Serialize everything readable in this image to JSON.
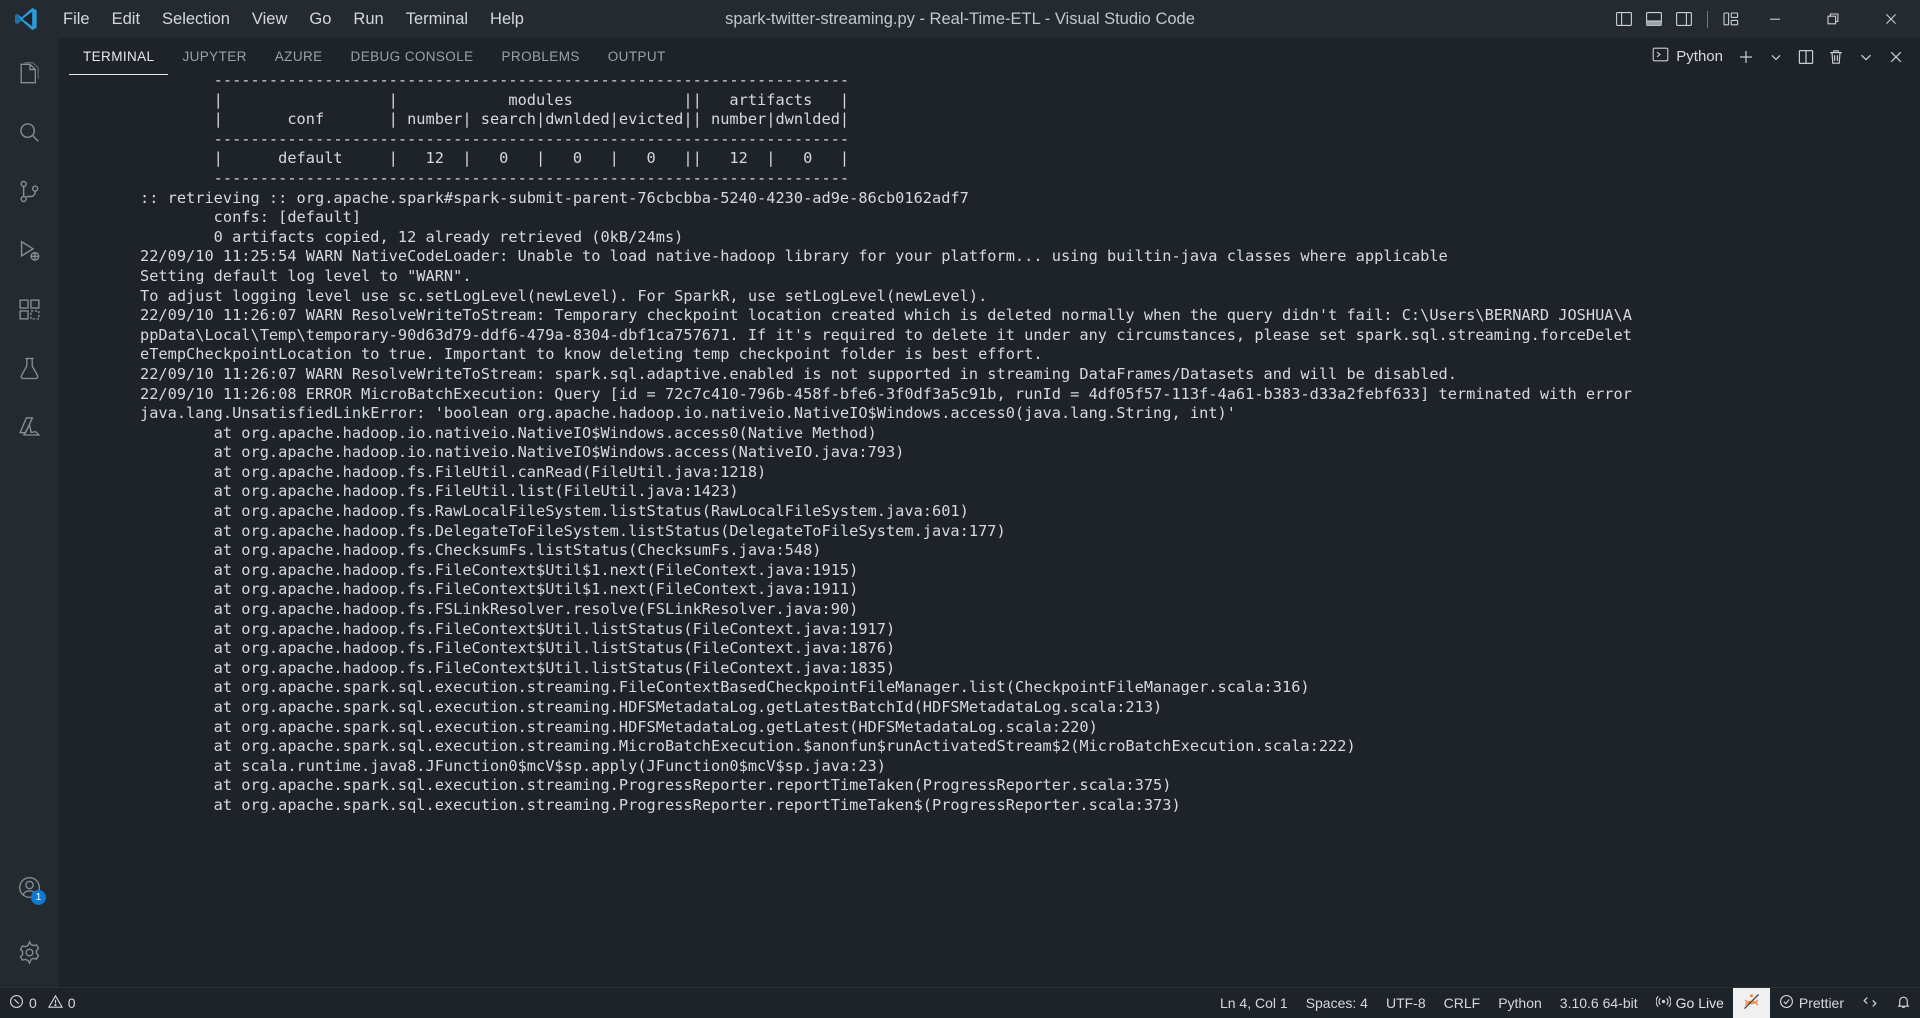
{
  "titlebar": {
    "logo_icon": "vscode-logo-icon",
    "menus": [
      "File",
      "Edit",
      "Selection",
      "View",
      "Go",
      "Run",
      "Terminal",
      "Help"
    ],
    "window_title": "spark-twitter-streaming.py - Real-Time-ETL - Visual Studio Code",
    "layout_buttons": [
      {
        "icon": "toggle-primary-sidebar-icon",
        "name": "toggle-primary-sidebar"
      },
      {
        "icon": "toggle-panel-icon",
        "name": "toggle-panel"
      },
      {
        "icon": "toggle-secondary-sidebar-icon",
        "name": "toggle-secondary-sidebar"
      },
      {
        "icon": "customize-layout-icon",
        "name": "customize-layout"
      }
    ],
    "window_controls": [
      {
        "name": "minimize-button",
        "icon": "minimize-icon"
      },
      {
        "name": "restore-button",
        "icon": "restore-icon"
      },
      {
        "name": "close-button",
        "icon": "close-icon"
      }
    ]
  },
  "activitybar": {
    "items": [
      {
        "name": "explorer",
        "icon": "files-icon"
      },
      {
        "name": "search",
        "icon": "search-icon"
      },
      {
        "name": "source-control",
        "icon": "source-control-icon"
      },
      {
        "name": "run-and-debug",
        "icon": "debug-icon"
      },
      {
        "name": "extensions",
        "icon": "extensions-icon"
      },
      {
        "name": "testing",
        "icon": "beaker-icon"
      },
      {
        "name": "azure",
        "icon": "azure-icon"
      }
    ],
    "bottom_items": [
      {
        "name": "accounts",
        "icon": "account-icon",
        "badge": "1"
      },
      {
        "name": "manage",
        "icon": "gear-icon",
        "badge": ""
      }
    ]
  },
  "panel": {
    "tabs": [
      {
        "label": "TERMINAL",
        "active": true
      },
      {
        "label": "JUPYTER",
        "active": false
      },
      {
        "label": "AZURE",
        "active": false
      },
      {
        "label": "DEBUG CONSOLE",
        "active": false
      },
      {
        "label": "PROBLEMS",
        "active": false
      },
      {
        "label": "OUTPUT",
        "active": false
      }
    ],
    "terminal_name": "Python",
    "terminal_icon": "terminal-chevron-icon",
    "actions": [
      {
        "name": "new-terminal-button",
        "icon": "plus-icon"
      },
      {
        "name": "terminal-dropdown-button",
        "icon": "chevron-down-icon"
      },
      {
        "name": "split-terminal-button",
        "icon": "split-icon"
      },
      {
        "name": "kill-terminal-button",
        "icon": "trash-icon"
      },
      {
        "name": "panel-views-button",
        "icon": "chevron-down-icon"
      },
      {
        "name": "close-panel-button",
        "icon": "close-icon"
      }
    ]
  },
  "terminal": {
    "lines": [
      "        ---------------------------------------------------------------------",
      "        |                  |            modules            ||   artifacts   |",
      "        |       conf       | number| search|dwnlded|evicted|| number|dwnlded|",
      "        ---------------------------------------------------------------------",
      "        |      default     |   12  |   0   |   0   |   0   ||   12  |   0   |",
      "        ---------------------------------------------------------------------",
      ":: retrieving :: org.apache.spark#spark-submit-parent-76cbcbba-5240-4230-ad9e-86cb0162adf7",
      "        confs: [default]",
      "        0 artifacts copied, 12 already retrieved (0kB/24ms)",
      "22/09/10 11:25:54 WARN NativeCodeLoader: Unable to load native-hadoop library for your platform... using builtin-java classes where applicable",
      "Setting default log level to \"WARN\".",
      "To adjust logging level use sc.setLogLevel(newLevel). For SparkR, use setLogLevel(newLevel).",
      "22/09/10 11:26:07 WARN ResolveWriteToStream: Temporary checkpoint location created which is deleted normally when the query didn't fail: C:\\Users\\BERNARD JOSHUA\\A",
      "ppData\\Local\\Temp\\temporary-90d63d79-ddf6-479a-8304-dbf1ca757671. If it's required to delete it under any circumstances, please set spark.sql.streaming.forceDelet",
      "eTempCheckpointLocation to true. Important to know deleting temp checkpoint folder is best effort.",
      "22/09/10 11:26:07 WARN ResolveWriteToStream: spark.sql.adaptive.enabled is not supported in streaming DataFrames/Datasets and will be disabled.",
      "22/09/10 11:26:08 ERROR MicroBatchExecution: Query [id = 72c7c410-796b-458f-bfe6-3f0df3a5c91b, runId = 4df05f57-113f-4a61-b383-d33a2febf633] terminated with error",
      "java.lang.UnsatisfiedLinkError: 'boolean org.apache.hadoop.io.nativeio.NativeIO$Windows.access0(java.lang.String, int)'",
      "        at org.apache.hadoop.io.nativeio.NativeIO$Windows.access0(Native Method)",
      "        at org.apache.hadoop.io.nativeio.NativeIO$Windows.access(NativeIO.java:793)",
      "        at org.apache.hadoop.fs.FileUtil.canRead(FileUtil.java:1218)",
      "        at org.apache.hadoop.fs.FileUtil.list(FileUtil.java:1423)",
      "        at org.apache.hadoop.fs.RawLocalFileSystem.listStatus(RawLocalFileSystem.java:601)",
      "        at org.apache.hadoop.fs.DelegateToFileSystem.listStatus(DelegateToFileSystem.java:177)",
      "        at org.apache.hadoop.fs.ChecksumFs.listStatus(ChecksumFs.java:548)",
      "        at org.apache.hadoop.fs.FileContext$Util$1.next(FileContext.java:1915)",
      "        at org.apache.hadoop.fs.FileContext$Util$1.next(FileContext.java:1911)",
      "        at org.apache.hadoop.fs.FSLinkResolver.resolve(FSLinkResolver.java:90)",
      "        at org.apache.hadoop.fs.FileContext$Util.listStatus(FileContext.java:1917)",
      "        at org.apache.hadoop.fs.FileContext$Util.listStatus(FileContext.java:1876)",
      "        at org.apache.hadoop.fs.FileContext$Util.listStatus(FileContext.java:1835)",
      "        at org.apache.spark.sql.execution.streaming.FileContextBasedCheckpointFileManager.list(CheckpointFileManager.scala:316)",
      "        at org.apache.spark.sql.execution.streaming.HDFSMetadataLog.getLatestBatchId(HDFSMetadataLog.scala:213)",
      "        at org.apache.spark.sql.execution.streaming.HDFSMetadataLog.getLatest(HDFSMetadataLog.scala:220)",
      "        at org.apache.spark.sql.execution.streaming.MicroBatchExecution.$anonfun$runActivatedStream$2(MicroBatchExecution.scala:222)",
      "        at scala.runtime.java8.JFunction0$mcV$sp.apply(JFunction0$mcV$sp.java:23)",
      "        at org.apache.spark.sql.execution.streaming.ProgressReporter.reportTimeTaken(ProgressReporter.scala:375)",
      "        at org.apache.spark.sql.execution.streaming.ProgressReporter.reportTimeTaken$(ProgressReporter.scala:373)"
    ]
  },
  "statusbar": {
    "errors_icon": "error-icon",
    "errors_count": "0",
    "warnings_icon": "warning-icon",
    "warnings_count": "0",
    "cursor_position": "Ln 4, Col 1",
    "indentation": "Spaces: 4",
    "encoding": "UTF-8",
    "eol": "CRLF",
    "language": "Python",
    "interpreter": "3.10.6 64-bit",
    "go_live": "Go Live",
    "go_live_icon": "broadcast-icon",
    "jupyter_icon": "jupyter-server-icon",
    "prettier": "Prettier",
    "prettier_icon": "check-circle-icon",
    "remote_icon": "remote-indicator-icon",
    "bell_icon": "bell-icon"
  },
  "colors": {
    "accent": "#0e7ad4",
    "titlebar_bg": "#252a31",
    "panel_bg": "#1e232a",
    "text": "#d6dae0",
    "muted": "#9ba0a8",
    "badge": "#0e7ad4"
  }
}
